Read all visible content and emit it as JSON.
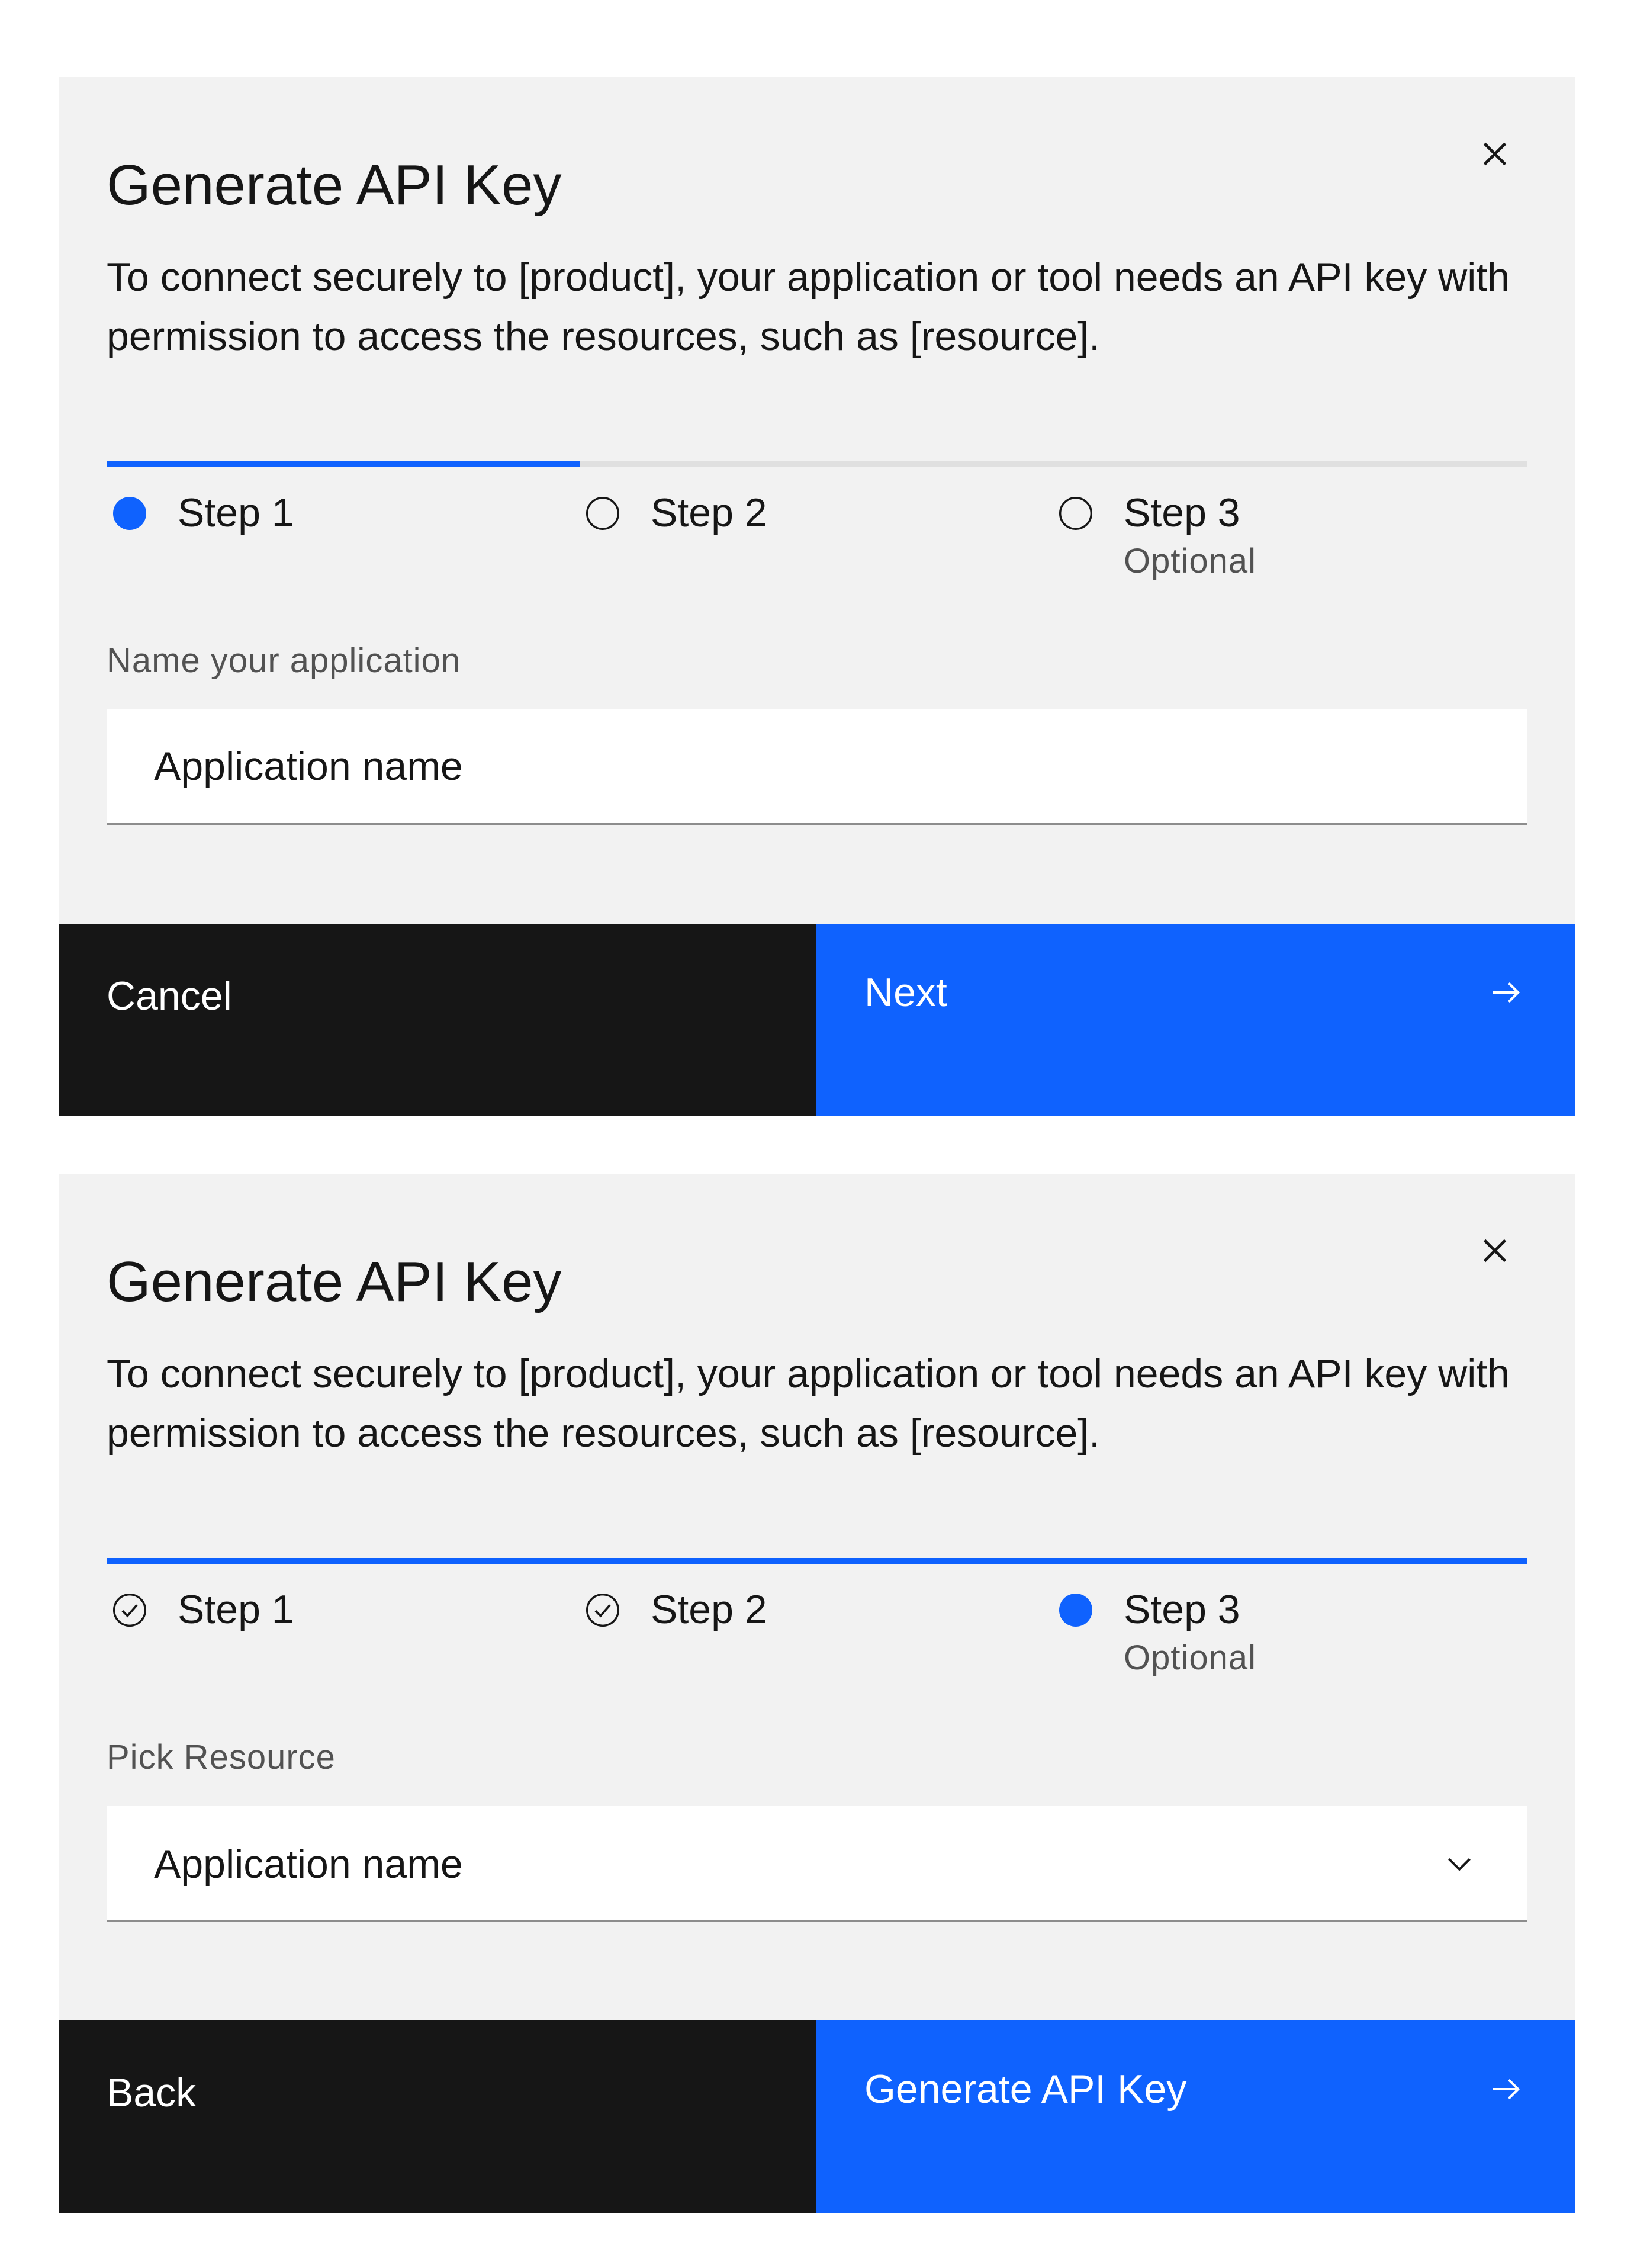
{
  "colors": {
    "modal_bg": "#f2f2f2",
    "primary": "#0f62fe",
    "secondary": "#161616",
    "track": "#e0e0e0",
    "text": "#161616",
    "muted": "#525252"
  },
  "modals": [
    {
      "title": "Generate API Key",
      "description": "To connect securely to [product], your application or tool needs an API key with permission to access the resources, such as [resource].",
      "close_icon": "close-icon",
      "progress": 0.3333,
      "steps": [
        {
          "label": "Step 1",
          "state": "current",
          "icon": "filled-circle-icon"
        },
        {
          "label": "Step 2",
          "state": "incomplete",
          "icon": "empty-circle-icon"
        },
        {
          "label": "Step 3",
          "state": "incomplete",
          "icon": "empty-circle-icon",
          "sub": "Optional"
        }
      ],
      "field": {
        "label": "Name your application",
        "placeholder": "Application name"
      },
      "secondary_label": "Cancel",
      "primary_label": "Next",
      "primary_icon": "arrow-right-icon"
    },
    {
      "title": "Generate API Key",
      "description": "To connect securely to [product], your application or tool needs an API key with permission to access the resources, such as [resource].",
      "close_icon": "close-icon",
      "progress": 1.0,
      "steps": [
        {
          "label": "Step 1",
          "state": "complete",
          "icon": "checkmark-circle-icon"
        },
        {
          "label": "Step 2",
          "state": "complete",
          "icon": "checkmark-circle-icon"
        },
        {
          "label": "Step 3",
          "state": "current",
          "icon": "filled-circle-icon",
          "sub": "Optional"
        }
      ],
      "field": {
        "label": "Pick Resource",
        "value": "Application name",
        "icon": "chevron-down-icon"
      },
      "secondary_label": "Back",
      "primary_label": "Generate API Key",
      "primary_icon": "arrow-right-icon"
    }
  ]
}
